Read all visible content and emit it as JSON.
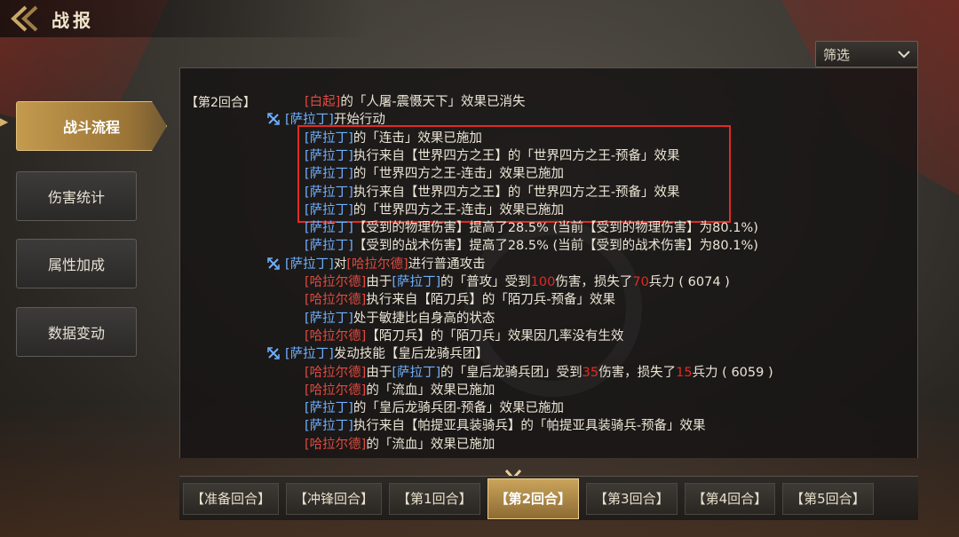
{
  "header": {
    "title": "战报",
    "back_icon": "back-chevron-icon"
  },
  "filter": {
    "label": "筛选",
    "icon": "chevron-down-icon"
  },
  "menu": [
    {
      "label": "战斗流程",
      "active": true
    },
    {
      "label": "伤害统计",
      "active": false
    },
    {
      "label": "属性加成",
      "active": false
    },
    {
      "label": "数据变动",
      "active": false
    }
  ],
  "log": {
    "round_label": "【第2回合】",
    "lines": [
      {
        "indent": 2,
        "icon": false,
        "segments": [
          {
            "t": "[白起]",
            "c": "red"
          },
          {
            "t": "的「人屠-震慑天下」效果已消失",
            "c": ""
          }
        ]
      },
      {
        "indent": 1,
        "icon": true,
        "segments": [
          {
            "t": "[萨拉丁]",
            "c": "blue"
          },
          {
            "t": "开始行动",
            "c": ""
          }
        ]
      },
      {
        "indent": 2,
        "icon": false,
        "segments": [
          {
            "t": "[萨拉丁]",
            "c": "blue"
          },
          {
            "t": "的「连击」效果已施加",
            "c": ""
          }
        ]
      },
      {
        "indent": 2,
        "icon": false,
        "segments": [
          {
            "t": "[萨拉丁]",
            "c": "blue"
          },
          {
            "t": "执行来自【世界四方之王】的「世界四方之王-预备」效果",
            "c": ""
          }
        ]
      },
      {
        "indent": 2,
        "icon": false,
        "segments": [
          {
            "t": "[萨拉丁]",
            "c": "blue"
          },
          {
            "t": "的「世界四方之王-连击」效果已施加",
            "c": ""
          }
        ]
      },
      {
        "indent": 2,
        "icon": false,
        "segments": [
          {
            "t": "[萨拉丁]",
            "c": "blue"
          },
          {
            "t": "执行来自【世界四方之王】的「世界四方之王-预备」效果",
            "c": ""
          }
        ]
      },
      {
        "indent": 2,
        "icon": false,
        "segments": [
          {
            "t": "[萨拉丁]",
            "c": "blue"
          },
          {
            "t": "的「世界四方之王-连击」效果已施加",
            "c": ""
          }
        ]
      },
      {
        "indent": 2,
        "icon": false,
        "segments": [
          {
            "t": "[萨拉丁]",
            "c": "blue"
          },
          {
            "t": "【受到的物理伤害】提高了28.5% (当前【受到的物理伤害】为80.1%)",
            "c": ""
          }
        ]
      },
      {
        "indent": 2,
        "icon": false,
        "segments": [
          {
            "t": "[萨拉丁]",
            "c": "blue"
          },
          {
            "t": "【受到的战术伤害】提高了28.5% (当前【受到的战术伤害】为80.1%)",
            "c": ""
          }
        ]
      },
      {
        "indent": 1,
        "icon": true,
        "segments": [
          {
            "t": "[萨拉丁]",
            "c": "blue"
          },
          {
            "t": "对",
            "c": ""
          },
          {
            "t": "[哈拉尔德]",
            "c": "red"
          },
          {
            "t": "进行普通攻击",
            "c": ""
          }
        ]
      },
      {
        "indent": 2,
        "icon": false,
        "segments": [
          {
            "t": "[哈拉尔德]",
            "c": "red"
          },
          {
            "t": "由于",
            "c": ""
          },
          {
            "t": "[萨拉丁]",
            "c": "blue"
          },
          {
            "t": "的「普攻」受到",
            "c": ""
          },
          {
            "t": "100",
            "c": "num"
          },
          {
            "t": "伤害，损失了",
            "c": ""
          },
          {
            "t": "70",
            "c": "num"
          },
          {
            "t": "兵力 ( 6074 )",
            "c": ""
          }
        ]
      },
      {
        "indent": 2,
        "icon": false,
        "segments": [
          {
            "t": "[哈拉尔德]",
            "c": "red"
          },
          {
            "t": "执行来自【陌刀兵】的「陌刀兵-预备」效果",
            "c": ""
          }
        ]
      },
      {
        "indent": 2,
        "icon": false,
        "segments": [
          {
            "t": "[萨拉丁]",
            "c": "blue"
          },
          {
            "t": "处于敏捷比自身高的状态",
            "c": ""
          }
        ]
      },
      {
        "indent": 2,
        "icon": false,
        "segments": [
          {
            "t": "[哈拉尔德]",
            "c": "red"
          },
          {
            "t": "【陌刀兵】的「陌刀兵」效果因几率没有生效",
            "c": ""
          }
        ]
      },
      {
        "indent": 1,
        "icon": true,
        "segments": [
          {
            "t": "[萨拉丁]",
            "c": "blue"
          },
          {
            "t": "发动技能【皇后龙骑兵团】",
            "c": ""
          }
        ]
      },
      {
        "indent": 2,
        "icon": false,
        "segments": [
          {
            "t": "[哈拉尔德]",
            "c": "red"
          },
          {
            "t": "由于",
            "c": ""
          },
          {
            "t": "[萨拉丁]",
            "c": "blue"
          },
          {
            "t": "的「皇后龙骑兵团」受到",
            "c": ""
          },
          {
            "t": "35",
            "c": "num"
          },
          {
            "t": "伤害，损失了",
            "c": ""
          },
          {
            "t": "15",
            "c": "num"
          },
          {
            "t": "兵力 ( 6059 )",
            "c": ""
          }
        ]
      },
      {
        "indent": 2,
        "icon": false,
        "segments": [
          {
            "t": "[哈拉尔德]",
            "c": "red"
          },
          {
            "t": "的「流血」效果已施加",
            "c": ""
          }
        ]
      },
      {
        "indent": 2,
        "icon": false,
        "segments": [
          {
            "t": "[萨拉丁]",
            "c": "blue"
          },
          {
            "t": "的「皇后龙骑兵团-预备」效果已施加",
            "c": ""
          }
        ]
      },
      {
        "indent": 2,
        "icon": false,
        "segments": [
          {
            "t": "[萨拉丁]",
            "c": "blue"
          },
          {
            "t": "执行来自【帕提亚具装骑兵】的「帕提亚具装骑兵-预备」效果",
            "c": ""
          }
        ]
      },
      {
        "indent": 2,
        "icon": false,
        "segments": [
          {
            "t": "[哈拉尔德]",
            "c": "red"
          },
          {
            "t": "的「流血」效果已施加",
            "c": ""
          }
        ]
      }
    ]
  },
  "tabs": [
    {
      "label": "【准备回合】",
      "active": false
    },
    {
      "label": "【冲锋回合】",
      "active": false
    },
    {
      "label": "【第1回合】",
      "active": false
    },
    {
      "label": "【第2回合】",
      "active": true
    },
    {
      "label": "【第3回合】",
      "active": false
    },
    {
      "label": "【第4回合】",
      "active": false
    },
    {
      "label": "【第5回合】",
      "active": false
    }
  ],
  "colors": {
    "enemy": "#e04a40",
    "ally": "#6fb0ff",
    "accent_gold": "#c49a4e",
    "highlight": "#e22b22"
  }
}
